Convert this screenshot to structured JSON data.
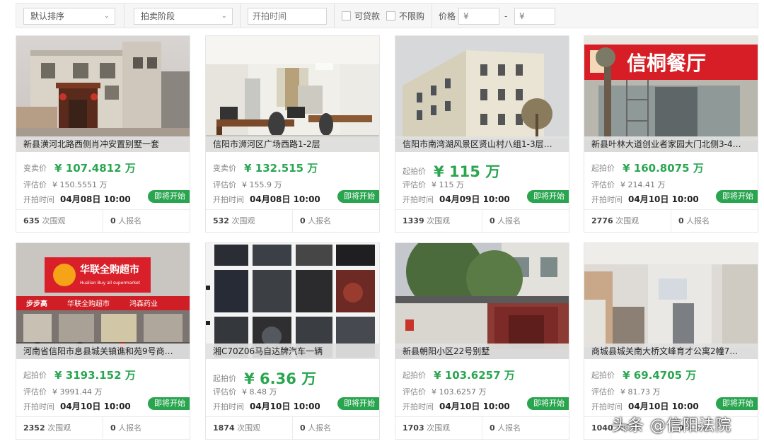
{
  "filters": {
    "sort": "默认排序",
    "stage": "拍卖阶段",
    "start_time": "开拍时间",
    "loan": "可贷款",
    "no_limit": "不限购",
    "price_label": "价格",
    "price_min": "¥",
    "dash": "-",
    "price_max": "¥"
  },
  "cards": [
    {
      "title": "新县潢河北路西侧肖冲安置别墅一套",
      "price_label": "变卖价",
      "price": "¥ 107.4812 万",
      "eval_label": "评估价",
      "eval": "¥ 150.5551 万",
      "start_label": "开拍时间",
      "start": "04月08日 10:00",
      "badge": "即将开始",
      "views": "635",
      "views_unit": "次围观",
      "signups": "0",
      "signups_unit": "人报名"
    },
    {
      "title": "信阳市浉河区广场西路1-2层",
      "price_label": "变卖价",
      "price": "¥ 132.515 万",
      "eval_label": "评估价",
      "eval": "¥ 155.9 万",
      "start_label": "开拍时间",
      "start": "04月08日 10:00",
      "badge": "即将开始",
      "views": "532",
      "views_unit": "次围观",
      "signups": "0",
      "signups_unit": "人报名"
    },
    {
      "title": "信阳市南湾湖风景区贤山村八组1-3层…",
      "price_label": "起拍价",
      "price": "¥ 115 万",
      "eval_label": "评估价",
      "eval": "¥ 115 万",
      "start_label": "开拍时间",
      "start": "04月09日 10:00",
      "badge": "即将开始",
      "views": "1339",
      "views_unit": "次围观",
      "signups": "0",
      "signups_unit": "人报名"
    },
    {
      "title": "新县叶林大道创业者家园大门北侧3-4…",
      "price_label": "起拍价",
      "price": "¥ 160.8075 万",
      "eval_label": "评估价",
      "eval": "¥ 214.41 万",
      "start_label": "开拍时间",
      "start": "04月10日 10:00",
      "badge": "即将开始",
      "views": "2776",
      "views_unit": "次围观",
      "signups": "0",
      "signups_unit": "人报名"
    },
    {
      "title": "河南省信阳市息县城关镇谯和苑9号商…",
      "price_label": "起拍价",
      "price": "¥ 3193.152 万",
      "eval_label": "评估价",
      "eval": "¥ 3991.44 万",
      "start_label": "开拍时间",
      "start": "04月10日 10:00",
      "badge": "即将开始",
      "views": "2352",
      "views_unit": "次围观",
      "signups": "0",
      "signups_unit": "人报名"
    },
    {
      "title": "湘C70Z06马自达牌汽车一辆",
      "price_label": "起拍价",
      "price": "¥ 6.36 万",
      "eval_label": "评估价",
      "eval": "¥ 8.48 万",
      "start_label": "开拍时间",
      "start": "04月10日 10:00",
      "badge": "即将开始",
      "views": "1874",
      "views_unit": "次围观",
      "signups": "0",
      "signups_unit": "人报名"
    },
    {
      "title": "新县朝阳小区22号别墅",
      "price_label": "起拍价",
      "price": "¥ 103.6257 万",
      "eval_label": "评估价",
      "eval": "¥ 103.6257 万",
      "start_label": "开拍时间",
      "start": "04月10日 10:00",
      "badge": "即将开始",
      "views": "1703",
      "views_unit": "次围观",
      "signups": "0",
      "signups_unit": "人报名"
    },
    {
      "title": "商城县城关南大桥文峰育才公寓2幢7…",
      "price_label": "起拍价",
      "price": "¥ 69.4705 万",
      "eval_label": "评估价",
      "eval": "¥ 81.73 万",
      "start_label": "开拍时间",
      "start": "04月10日 10:00",
      "badge": "即将开始",
      "views": "1040",
      "views_unit": "次围观",
      "signups": "0",
      "signups_unit": "人报名"
    }
  ],
  "signs": {
    "restaurant": "信桐餐厅",
    "supermarket": "华联全购超市",
    "supermarket_en": "Hualian Buy all supermarket",
    "shop1": "步步高",
    "shop2": "华联全购超市",
    "shop3": "鸿森药业"
  },
  "watermark": "头条 @信阳法院",
  "colors": {
    "accent": "#2aa651",
    "badge": "#29a54f"
  }
}
